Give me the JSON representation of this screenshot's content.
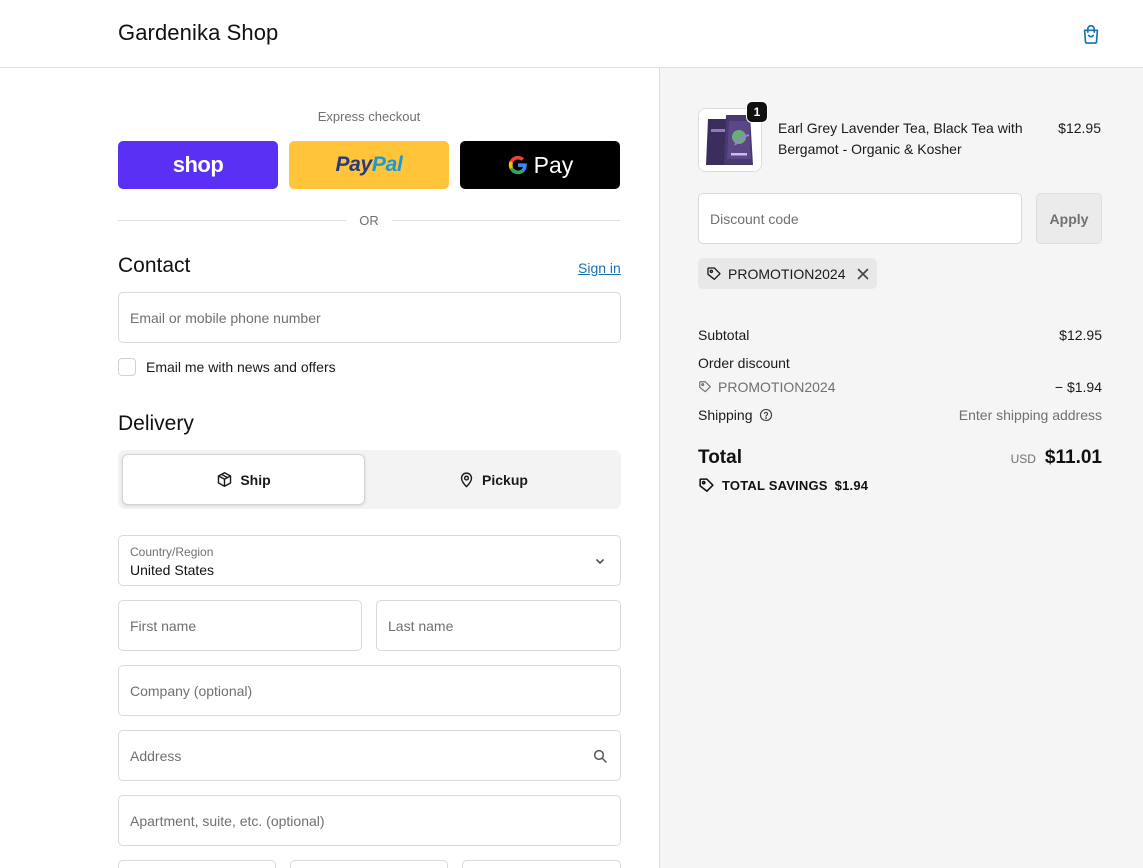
{
  "header": {
    "brand": "Gardenika Shop",
    "cart_icon": "shopping-bag-icon",
    "accent": "#1773b0"
  },
  "express": {
    "label": "Express checkout",
    "shop_label": "shop",
    "paypal_part1": "Pay",
    "paypal_part2": "Pal",
    "gpay_label": "Pay",
    "or_label": "OR",
    "colors": {
      "shop": "#5a31f4",
      "paypal": "#ffc439",
      "gpay": "#000000"
    }
  },
  "contact": {
    "title": "Contact",
    "signin": "Sign in",
    "email_placeholder": "Email or mobile phone number",
    "newsletter_label": "Email me with news and offers",
    "newsletter_checked": false
  },
  "delivery": {
    "title": "Delivery",
    "ship_label": "Ship",
    "pickup_label": "Pickup",
    "selected": "Ship",
    "country_label": "Country/Region",
    "country_value": "United States",
    "first_name_placeholder": "First name",
    "last_name_placeholder": "Last name",
    "company_placeholder": "Company (optional)",
    "address_placeholder": "Address",
    "apartment_placeholder": "Apartment, suite, etc. (optional)"
  },
  "summary": {
    "product": {
      "name": "Earl Grey Lavender Tea, Black Tea with Bergamot - Organic & Kosher",
      "price": "$12.95",
      "quantity": "1"
    },
    "discount_placeholder": "Discount code",
    "apply_label": "Apply",
    "applied_code": "PROMOTION2024",
    "subtotal_label": "Subtotal",
    "subtotal_value": "$12.95",
    "order_discount_label": "Order discount",
    "order_discount_code": "PROMOTION2024",
    "order_discount_value": "− $1.94",
    "shipping_label": "Shipping",
    "shipping_value": "Enter shipping address",
    "total_label": "Total",
    "currency": "USD",
    "total_value": "$11.01",
    "savings_label": "TOTAL SAVINGS",
    "savings_value": "$1.94"
  }
}
